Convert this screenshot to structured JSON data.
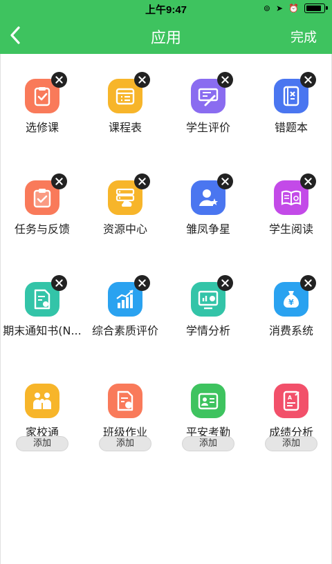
{
  "status_bar": {
    "time": "上午9:47"
  },
  "header": {
    "title": "应用",
    "done_label": "完成"
  },
  "apps": [
    {
      "label": "选修课",
      "icon": "clipboard-check-icon",
      "color": "#f97a5a",
      "action": "remove"
    },
    {
      "label": "课程表",
      "icon": "schedule-icon",
      "color": "#f7b52a",
      "action": "remove"
    },
    {
      "label": "学生评价",
      "icon": "evaluation-pen-icon",
      "color": "#8a6cf0",
      "action": "remove"
    },
    {
      "label": "错题本",
      "icon": "wrong-book-icon",
      "color": "#4a76f0",
      "action": "remove"
    },
    {
      "label": "任务与反馈",
      "icon": "task-clipboard-icon",
      "color": "#f97a5a",
      "action": "remove"
    },
    {
      "label": "资源中心",
      "icon": "server-cloud-icon",
      "color": "#f7b52a",
      "action": "remove"
    },
    {
      "label": "雏凤争星",
      "icon": "user-star-icon",
      "color": "#4a76f0",
      "action": "remove"
    },
    {
      "label": "学生阅读",
      "icon": "open-book-icon",
      "color": "#c34ae8",
      "action": "remove"
    },
    {
      "label": "期末通知书(N...",
      "icon": "certificate-doc-icon",
      "color": "#33c4a8",
      "action": "remove"
    },
    {
      "label": "综合素质评价",
      "icon": "growth-chart-icon",
      "color": "#2aa2f0",
      "action": "remove"
    },
    {
      "label": "学情分析",
      "icon": "analysis-board-icon",
      "color": "#33c4a8",
      "action": "remove"
    },
    {
      "label": "消费系统",
      "icon": "money-bag-icon",
      "color": "#2aa2f0",
      "action": "remove"
    },
    {
      "label": "家校通",
      "icon": "family-icon",
      "color": "#f7b52a",
      "action": "add"
    },
    {
      "label": "班级作业",
      "icon": "homework-doc-icon",
      "color": "#f97a5a",
      "action": "add"
    },
    {
      "label": "平安考勤",
      "icon": "id-card-icon",
      "color": "#3ec35f",
      "action": "add"
    },
    {
      "label": "成绩分析",
      "icon": "grade-book-icon",
      "color": "#f2506a",
      "action": "add"
    }
  ],
  "add_label": "添加"
}
